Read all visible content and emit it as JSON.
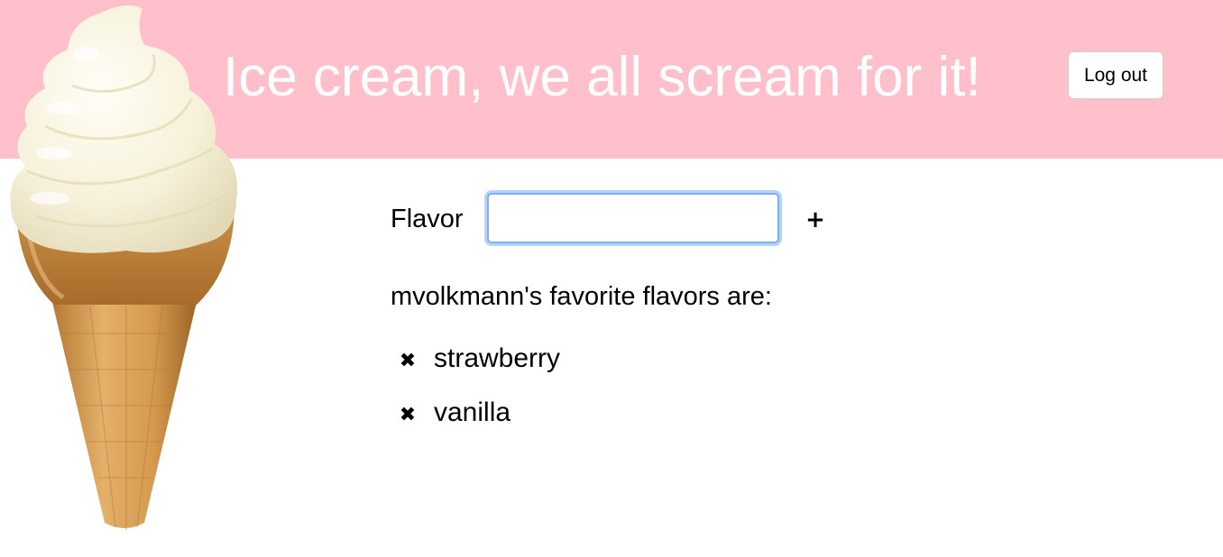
{
  "header": {
    "title": "Ice cream, we all scream for it!",
    "logout_label": "Log out",
    "background_color": "#ffc0cb"
  },
  "logo": {
    "icon": "ice-cream-cone-icon"
  },
  "form": {
    "flavor_label": "Flavor",
    "flavor_value": "",
    "add_label": "+"
  },
  "favorites": {
    "heading": "mvolkmann's favorite flavors are:",
    "delete_icon": "✖",
    "items": [
      {
        "name": "strawberry"
      },
      {
        "name": "vanilla"
      }
    ]
  }
}
